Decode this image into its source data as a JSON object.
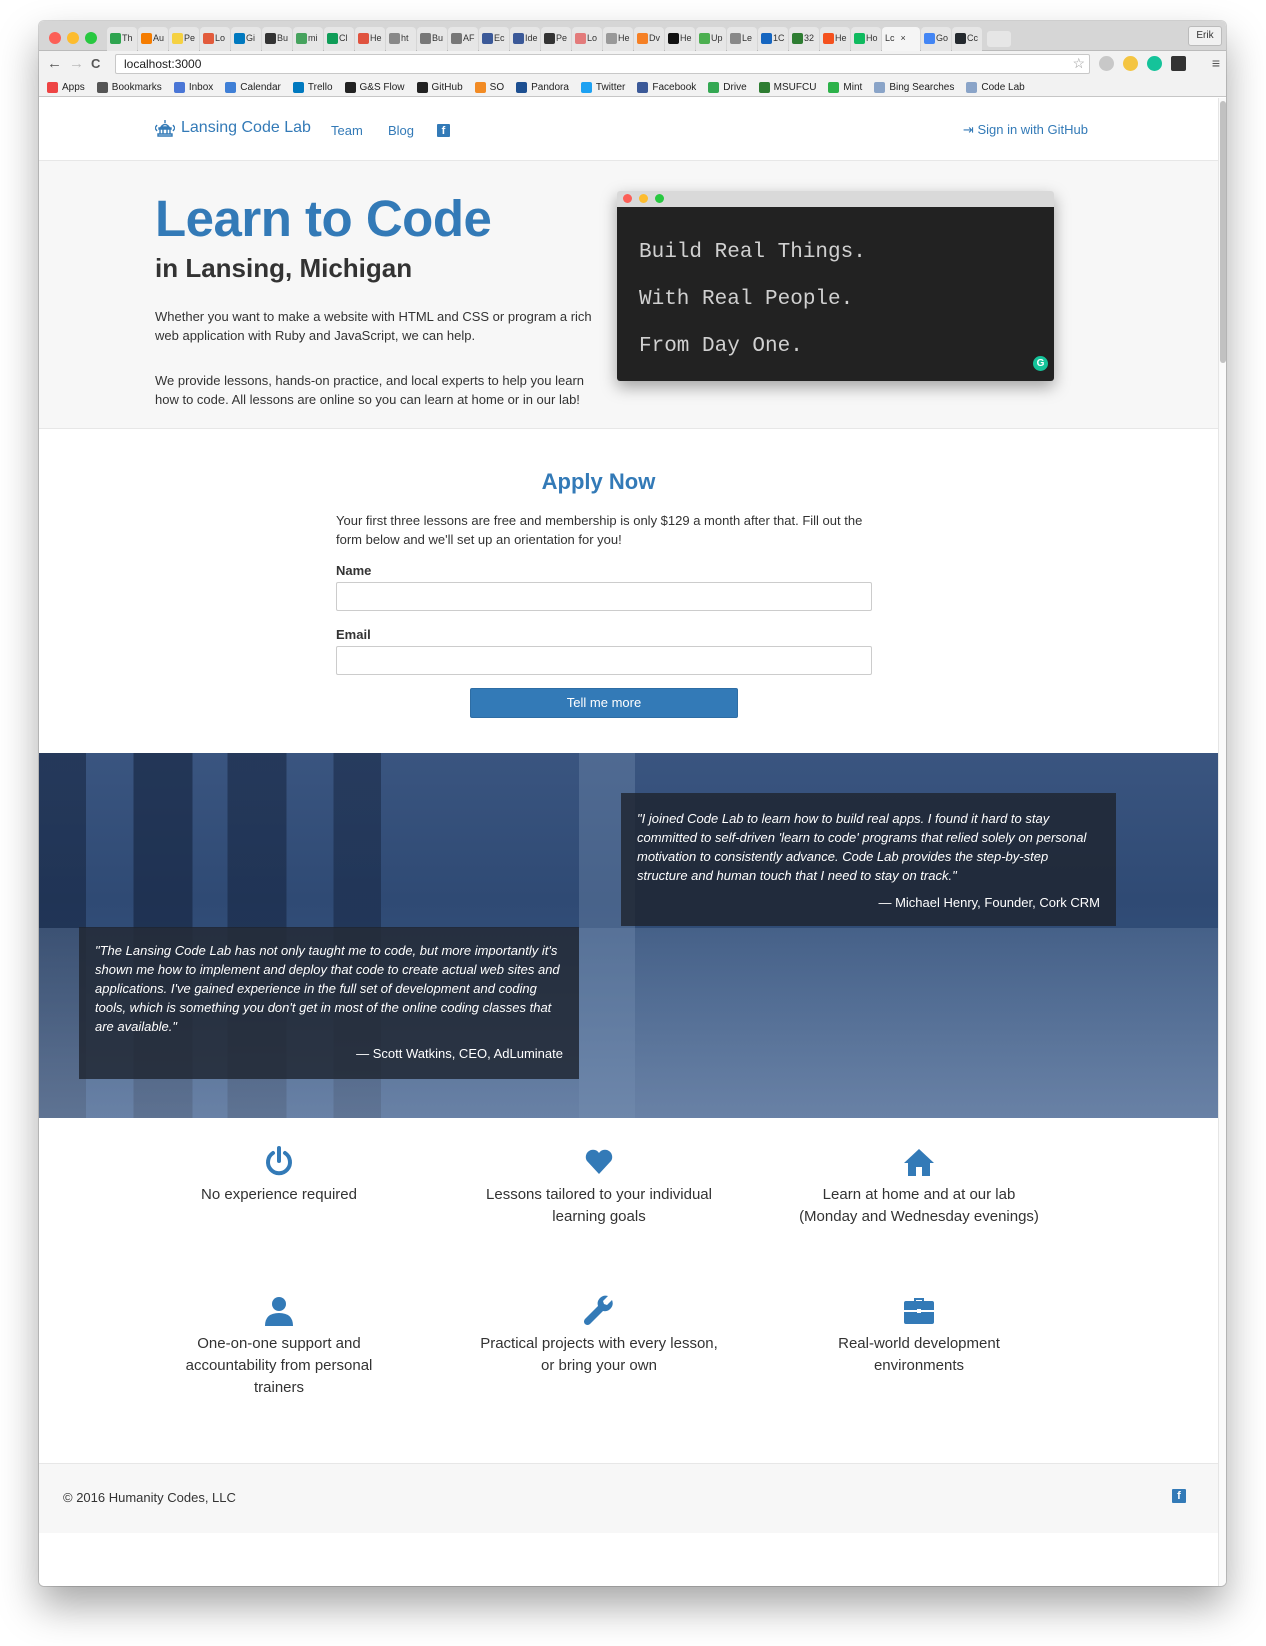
{
  "browser": {
    "tabs": [
      "Th",
      "Au",
      "Pe",
      "Lo",
      "Gi",
      "Bu",
      "mi",
      "Cl",
      "He",
      "ht",
      "Bu",
      "AF",
      "Ec",
      "Ide",
      "Pe",
      "Lo",
      "He",
      "Dv",
      "He",
      "Up",
      "Le",
      "1C",
      "32",
      "He",
      "Ho",
      "Lc",
      "Go",
      "Cc"
    ],
    "active_tab_close": "×",
    "user": "Erik",
    "url": "localhost:3000",
    "back": "←",
    "forward": "→",
    "reload": "C",
    "star": "☆",
    "menu": "≡",
    "bookmarks": [
      "Apps",
      "Bookmarks",
      "Inbox",
      "Calendar",
      "Trello",
      "G&S Flow",
      "GitHub",
      "SO",
      "Pandora",
      "Twitter",
      "Facebook",
      "Drive",
      "MSUFCU",
      "Mint",
      "Bing Searches",
      "Code Lab"
    ]
  },
  "nav": {
    "brand": "Lansing Code Lab",
    "team": "Team",
    "blog": "Blog",
    "facebook_glyph": "f",
    "signin": "Sign in with GitHub"
  },
  "hero": {
    "title": "Learn to Code",
    "subtitle": "in Lansing, Michigan",
    "p1": "Whether you want to make a website with HTML and CSS or program a rich web application with Ruby and JavaScript, we can help.",
    "p2": "We provide lessons, hands-on practice, and local experts to help you learn how to code. All lessons are online so you can learn at home or in our lab!",
    "terminal_lines": [
      "Build Real Things.",
      "With Real People.",
      "From Day One."
    ],
    "grammarly_glyph": "G"
  },
  "apply": {
    "title": "Apply Now",
    "text": "Your first three lessons are free and membership is only $129 a month after that. Fill out the form below and we'll set up an orientation for you!",
    "name_label": "Name",
    "email_label": "Email",
    "name_value": "",
    "email_value": "",
    "submit": "Tell me more"
  },
  "testimonials": [
    {
      "quote": "\"I joined Code Lab to learn how to build real apps. I found it hard to stay committed to self-driven 'learn to code' programs that relied solely on personal motivation to consistently advance. Code Lab provides the step-by-step structure and human touch that I need to stay on track.\"",
      "author": "— Michael Henry, Founder, Cork CRM"
    },
    {
      "quote": "\"The Lansing Code Lab has not only taught me to code, but more importantly it's shown me how to implement and deploy that code to create actual web sites and applications. I've gained experience in the full set of development and coding tools, which is something you don't get in most of the online coding classes that are available.\"",
      "author": "— Scott Watkins, CEO, AdLuminate"
    }
  ],
  "features": [
    {
      "icon": "power-icon",
      "text": "No experience required"
    },
    {
      "icon": "heart-icon",
      "text": "Lessons tailored to your individual learning goals"
    },
    {
      "icon": "home-icon",
      "text": "Learn at home and at our lab (Monday and Wednesday evenings)"
    },
    {
      "icon": "user-icon",
      "text": "One-on-one support and accountability from personal trainers"
    },
    {
      "icon": "wrench-icon",
      "text": "Practical projects with every lesson, or bring your own"
    },
    {
      "icon": "briefcase-icon",
      "text": "Real-world development environments"
    }
  ],
  "footer": {
    "copyright": "© 2016 Humanity Codes, LLC",
    "facebook_glyph": "f"
  },
  "colors": {
    "brand_blue": "#337ab7",
    "terminal_bg": "#222222",
    "quote_bg": "#1e2530"
  }
}
